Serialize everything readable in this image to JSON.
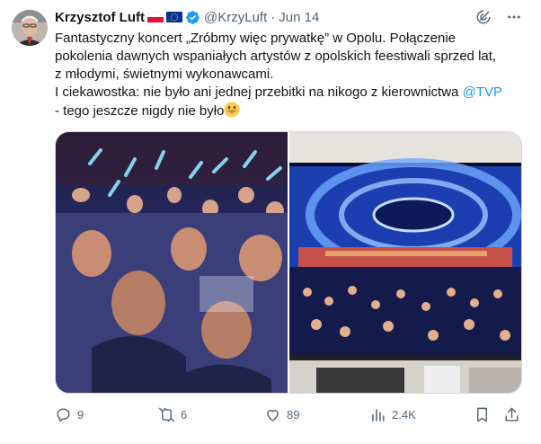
{
  "author": {
    "name": "Krzysztof Luft",
    "handle": "@KrzyLuft",
    "separator": "·",
    "date": "Jun 14"
  },
  "tweet": {
    "line1": "Fantastyczny koncert „Zróbmy więc prywatkę” w Opolu. Połączenie",
    "line2": "pokolenia dawnych wspaniałych artystów z opolskich feestiwali sprzed lat,",
    "line3": "z młodymi, świetnymi wykonawcami.",
    "line4_prefix": "I ciekawostka: nie było ani jednej przebitki na nikogo z kierownictwa ",
    "mention": "@TVP",
    "line5": "- tego jeszcze nigdy nie było"
  },
  "media": {
    "left": "concert-crowd-photo",
    "right": "tv-screen-stage-photo"
  },
  "actions": {
    "replies": "9",
    "reposts": "6",
    "likes": "89",
    "views": "2.4K"
  },
  "colors": {
    "text": "#0f1419",
    "muted": "#536471",
    "accent": "#1d9bf0",
    "verified": "#1d9bf0"
  },
  "icons": [
    "grok-icon",
    "more-icon",
    "reply-icon",
    "repost-icon",
    "like-icon",
    "views-icon",
    "bookmark-icon",
    "share-icon",
    "verified-badge-icon",
    "poland-flag-icon",
    "eu-flag-icon",
    "grinning-face-icon"
  ]
}
